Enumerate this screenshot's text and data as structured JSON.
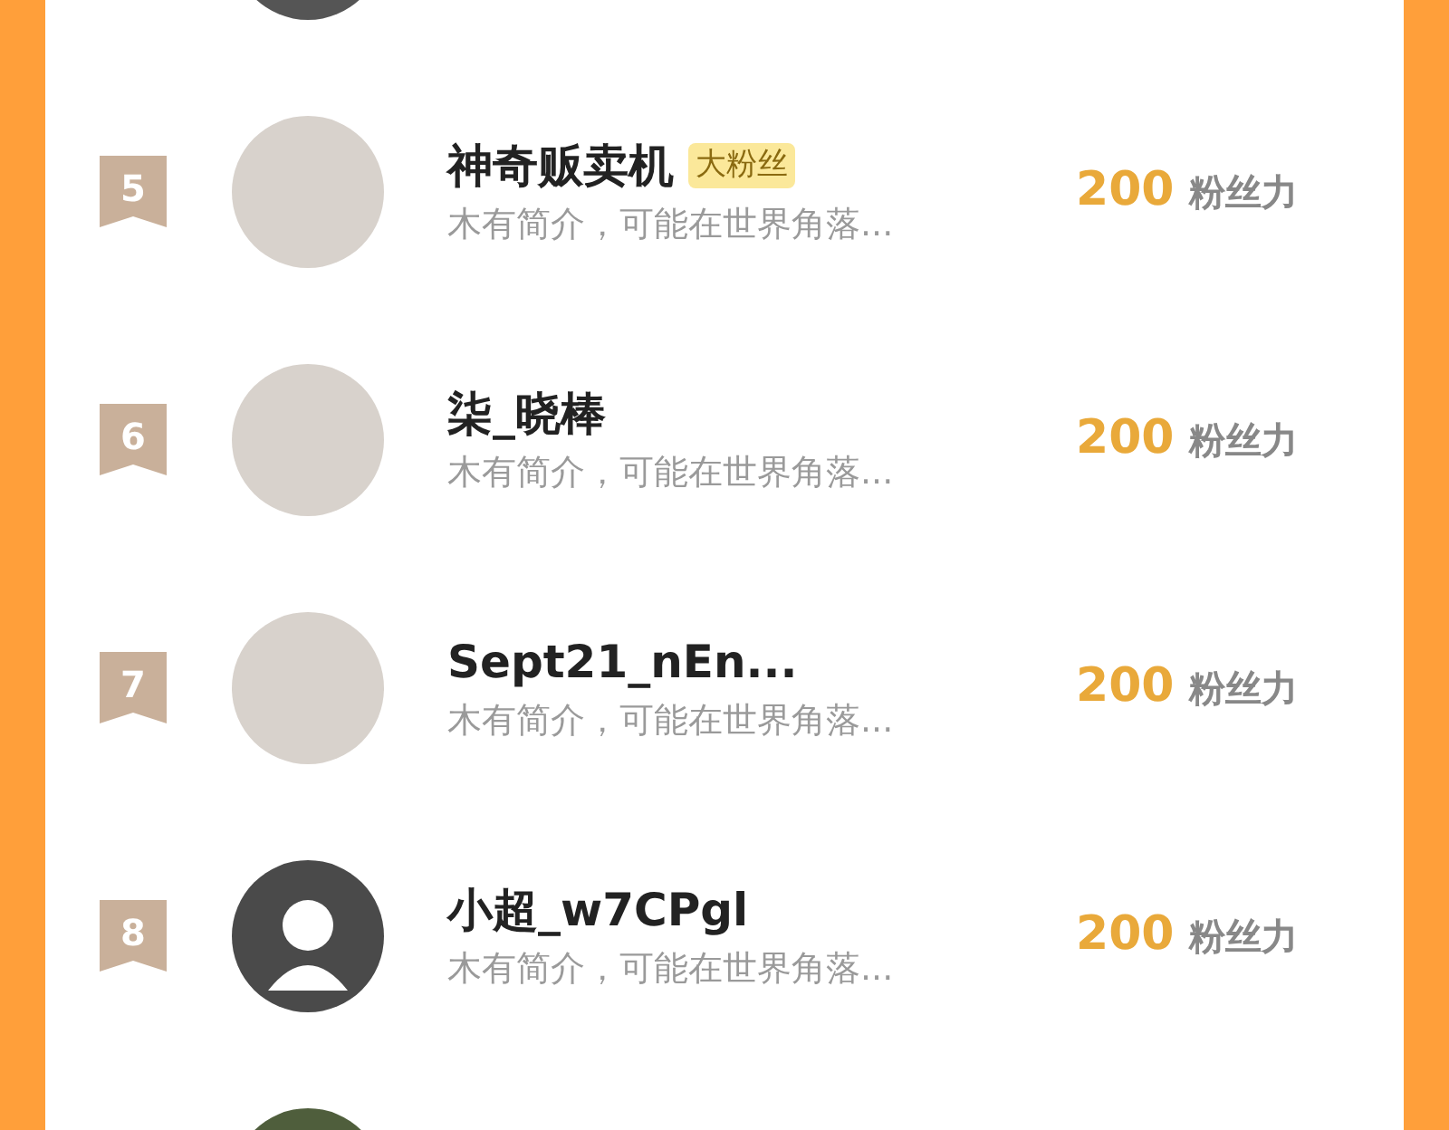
{
  "rows": [
    {
      "rank": "5",
      "name": "神奇贩卖机",
      "badge": "大粉丝",
      "bio": "木有简介，可能在世界角落...",
      "score": "200",
      "unit": "粉丝力",
      "kind": "photo"
    },
    {
      "rank": "6",
      "name": "柒_晓棒",
      "bio": "木有简介，可能在世界角落...",
      "score": "200",
      "unit": "粉丝力",
      "kind": "photo"
    },
    {
      "rank": "7",
      "name": "Sept21_nEn...",
      "bio": "木有简介，可能在世界角落...",
      "score": "200",
      "unit": "粉丝力",
      "kind": "photo"
    },
    {
      "rank": "8",
      "name": "小超_w7CPgl",
      "bio": "木有简介，可能在世界角落...",
      "score": "200",
      "unit": "粉丝力",
      "kind": "default"
    }
  ]
}
